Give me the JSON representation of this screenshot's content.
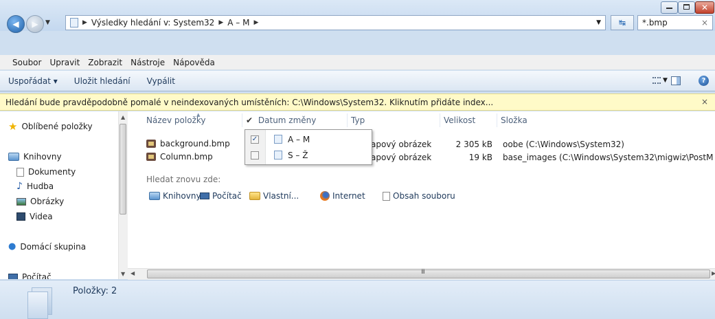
{
  "address": {
    "breadcrumb": [
      "Výsledky hledání v: System32",
      "A – M"
    ],
    "search_value": "*.bmp",
    "search_clear": "×"
  },
  "menu": [
    "Soubor",
    "Upravit",
    "Zobrazit",
    "Nástroje",
    "Nápověda"
  ],
  "toolbar": {
    "organize": "Uspořádat ▾",
    "save_search": "Uložit hledání",
    "burn": "Vypálit"
  },
  "infobar": {
    "text": "Hledání bude pravděpodobně pomalé v neindexovaných umístěních: C:\\Windows\\System32. Kliknutím přidáte index...",
    "close": "×"
  },
  "nav": {
    "favorites": "Oblíbené položky",
    "libraries": "Knihovny",
    "library_items": [
      "Dokumenty",
      "Hudba",
      "Obrázky",
      "Videa"
    ],
    "homegroup": "Domácí skupina",
    "computer": "Počítač"
  },
  "columns": {
    "name": "Název položky",
    "date": "Datum změny",
    "type": "Typ",
    "size": "Velikost",
    "folder": "Složka"
  },
  "files": [
    {
      "name": "background.bmp",
      "type": "apový obrázek",
      "size": "2 305 kB",
      "folder": "oobe (C:\\Windows\\System32)"
    },
    {
      "name": "Column.bmp",
      "type": "apový obrázek",
      "size": "19 kB",
      "folder": "base_images (C:\\Windows\\System32\\migwiz\\PostM"
    }
  ],
  "filter_dropdown": [
    {
      "label": "A – M",
      "checked": true
    },
    {
      "label": "S – Ž",
      "checked": false
    }
  ],
  "search_again": {
    "label": "Hledat znovu zde:",
    "links": [
      "Knihovny",
      "Počítač",
      "Vlastní...",
      "Internet",
      "Obsah souboru"
    ]
  },
  "status": {
    "count": "Položky: 2"
  },
  "scroll": {
    "h_thumb_label": "III"
  }
}
